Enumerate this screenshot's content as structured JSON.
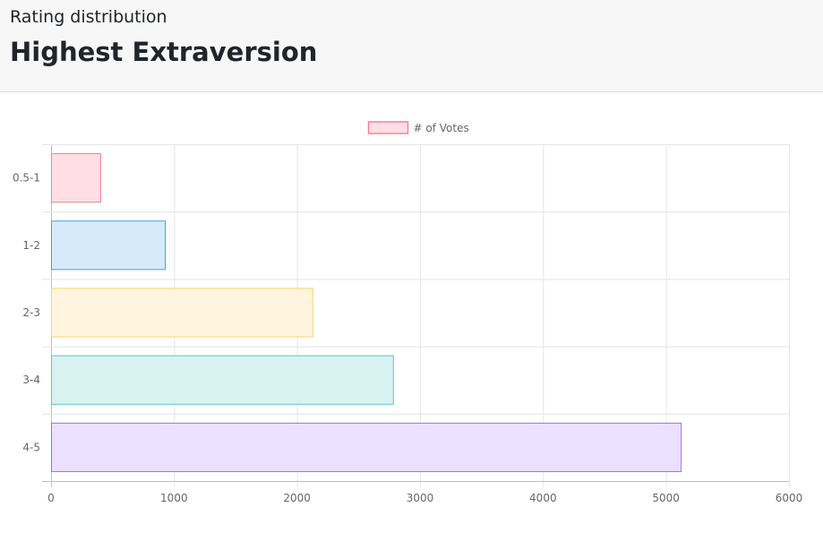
{
  "header": {
    "subtitle": "Rating distribution",
    "title": "Highest Extraversion"
  },
  "chart_data": {
    "type": "bar",
    "orientation": "horizontal",
    "categories": [
      "0.5-1",
      "1-2",
      "2-3",
      "3-4",
      "4-5"
    ],
    "series": [
      {
        "name": "# of Votes",
        "values": [
          400,
          925,
          2125,
          2780,
          5120
        ]
      }
    ],
    "bar_colors": [
      {
        "fill": "#ffdfe5",
        "stroke": "#f0829a"
      },
      {
        "fill": "#d6ebf9",
        "stroke": "#4aa0d5"
      },
      {
        "fill": "#fff4de",
        "stroke": "#f6d37a"
      },
      {
        "fill": "#d8f2f2",
        "stroke": "#5cc4c4"
      },
      {
        "fill": "#ebe0ff",
        "stroke": "#9d6ff0"
      }
    ],
    "legend_color": {
      "fill": "#ffdfe5",
      "stroke": "#f0829a"
    },
    "xlim": [
      0,
      6000
    ],
    "x_ticks": [
      0,
      1000,
      2000,
      3000,
      4000,
      5000,
      6000
    ],
    "grid": true,
    "legend_position": "top"
  }
}
